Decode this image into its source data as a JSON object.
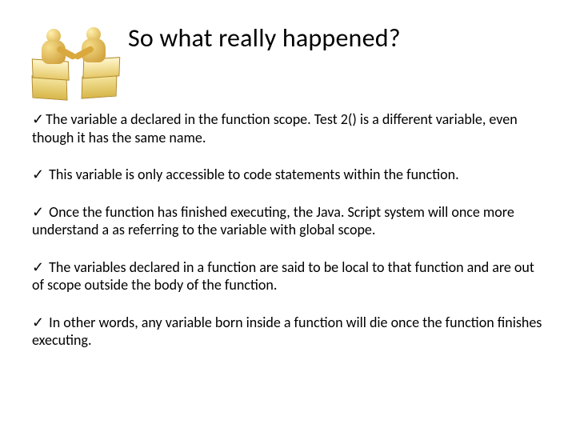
{
  "title": "So what really happened?",
  "checkmark": "✓",
  "bullets": [
    "The variable a declared in the function scope. Test 2() is a different variable, even though it has the same name.",
    " This variable is only accessible to code statements within the function.",
    " Once the function has finished executing, the Java. Script system will once more understand a as referring to the variable with global scope.",
    " The variables declared in a function are said to be local to that function and are out of scope outside the body of the function.",
    " In other words, any variable born inside a function will die once the function finishes executing."
  ]
}
